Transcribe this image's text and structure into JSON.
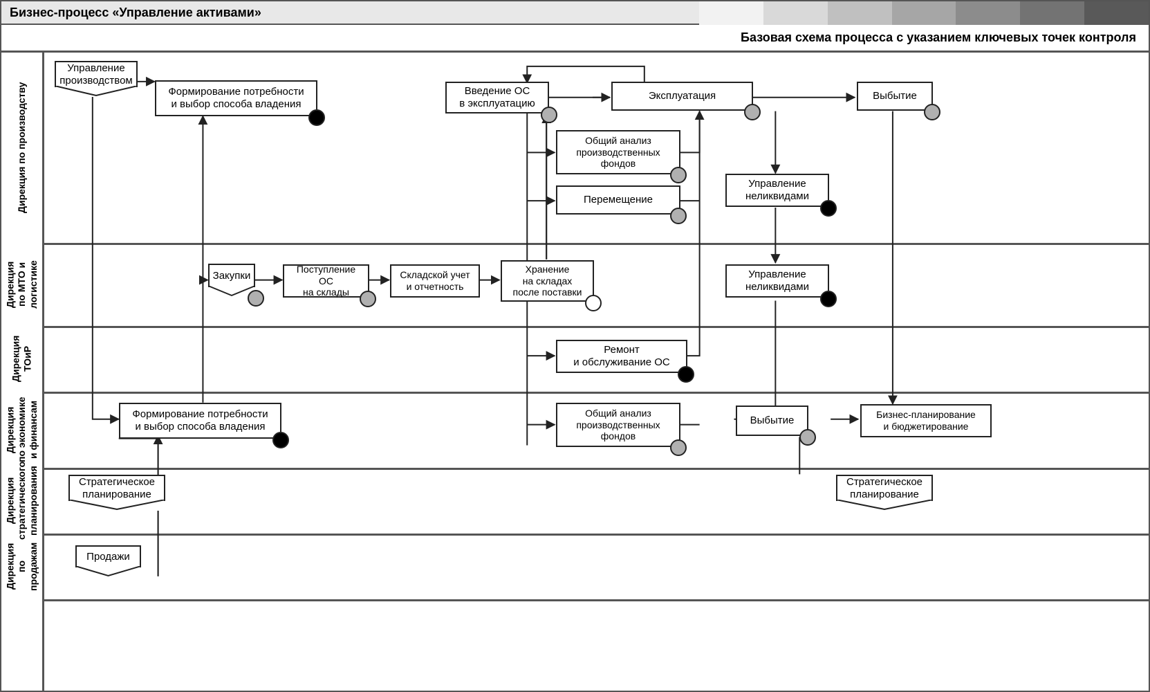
{
  "title": "Бизнес-процесс «Управление активами»",
  "subtitle": "Базовая схема процесса с указанием ключевых точек контроля",
  "lanes": [
    {
      "id": "l1",
      "label": "Дирекция по производству"
    },
    {
      "id": "l2",
      "label": "Дирекция\nпо МТО и логистике"
    },
    {
      "id": "l3",
      "label": "Дирекция ТОиР"
    },
    {
      "id": "l4",
      "label": "Дирекция\nпо экономике\nи финансам"
    },
    {
      "id": "l5",
      "label": "Дирекция\nстратегического\nпланирования"
    },
    {
      "id": "l6",
      "label": "Дирекция\nпо продажам"
    }
  ],
  "crests": {
    "c_prod": "Управление\nпроизводством",
    "c_purch": "Закупки",
    "c_strat1": "Стратегическое\nпланирование",
    "c_strat2": "Стратегическое\nпланирование",
    "c_sales": "Продажи"
  },
  "boxes": {
    "b_need1": "Формирование потребности\nи выбор способа владения",
    "b_intro": "Введение ОС\nв эксплуатацию",
    "b_oper": "Эксплуатация",
    "b_disp1": "Выбытие",
    "b_anal1": "Общий анализ\nпроизводственных\nфондов",
    "b_move": "Перемещение",
    "b_illiq1": "Управление\nнеликвидами",
    "b_recv": "Поступление ОС\nна склады",
    "b_stock": "Складской учет\nи отчетность",
    "b_store": "Хранение\nна складах\nпосле поставки",
    "b_illiq2": "Управление\nнеликвидами",
    "b_repair": "Ремонт\nи обслуживание ОС",
    "b_need2": "Формирование потребности\nи выбор способа владения",
    "b_anal2": "Общий анализ\nпроизводственных\nфондов",
    "b_disp2": "Выбытие",
    "b_budget": "Бизнес-планирование\nи бюджетирование"
  },
  "control_points": {
    "cp_need1": "black",
    "cp_intro": "gray",
    "cp_oper": "gray",
    "cp_disp1": "gray",
    "cp_anal1": "gray",
    "cp_move": "gray",
    "cp_illiq1": "black",
    "cp_purch": "gray",
    "cp_recv": "gray",
    "cp_store": "white",
    "cp_illiq2": "black",
    "cp_repair": "black",
    "cp_need2": "black",
    "cp_anal2": "gray",
    "cp_disp2": "gray"
  }
}
